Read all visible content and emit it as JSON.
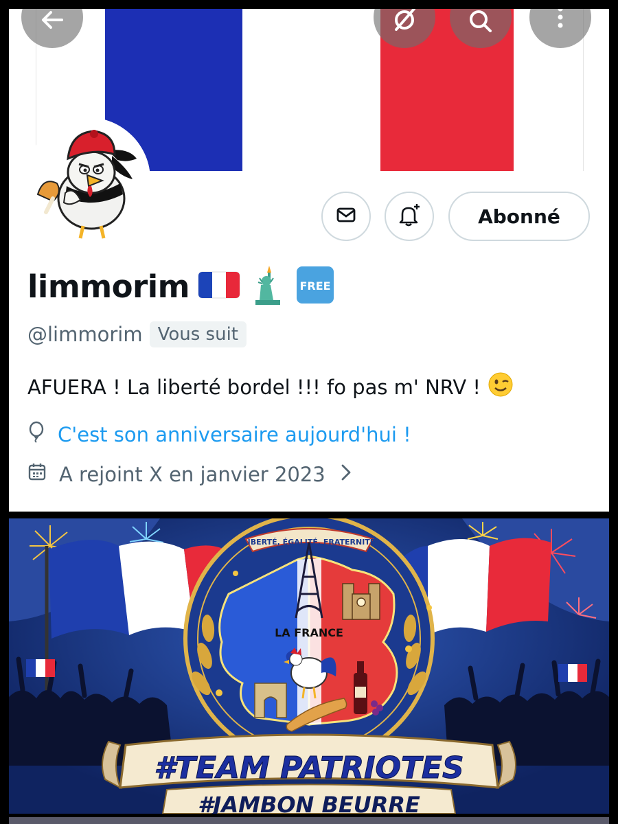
{
  "profile": {
    "display_name": "limmorim",
    "name_emojis": [
      "🇫🇷",
      "🗽",
      "🆓"
    ],
    "handle": "@limmorim",
    "follows_you_badge": "Vous suit",
    "bio": "AFUERA ! La liberté bordel !!! fo pas m' NRV !",
    "bio_emoji": "😉",
    "birthday_text": "C'est son anniversaire aujourd'hui !",
    "joined_text": "A rejoint X en janvier 2023",
    "follow_button_label": "Abonné"
  },
  "icons": {
    "back": "arrow-left-icon",
    "grok": "grok-icon",
    "search": "search-icon",
    "more": "more-vertical-icon",
    "message": "envelope-icon",
    "notify": "bell-plus-icon",
    "balloon": "balloon-icon",
    "calendar": "calendar-icon",
    "chevron": "chevron-right-icon"
  },
  "colors": {
    "flag_blue": "#1c2fb4",
    "flag_red": "#e82a3a",
    "link_blue": "#1d9bf0",
    "muted": "#536471"
  },
  "poster": {
    "motto": "LIBERTÉ, ÉGALITÉ, FRATERNITÉ",
    "map_label": "LA FRANCE",
    "banner_text": "#TEAM PATRIOTES",
    "sub_text": "#JAMBON BEURRE"
  }
}
